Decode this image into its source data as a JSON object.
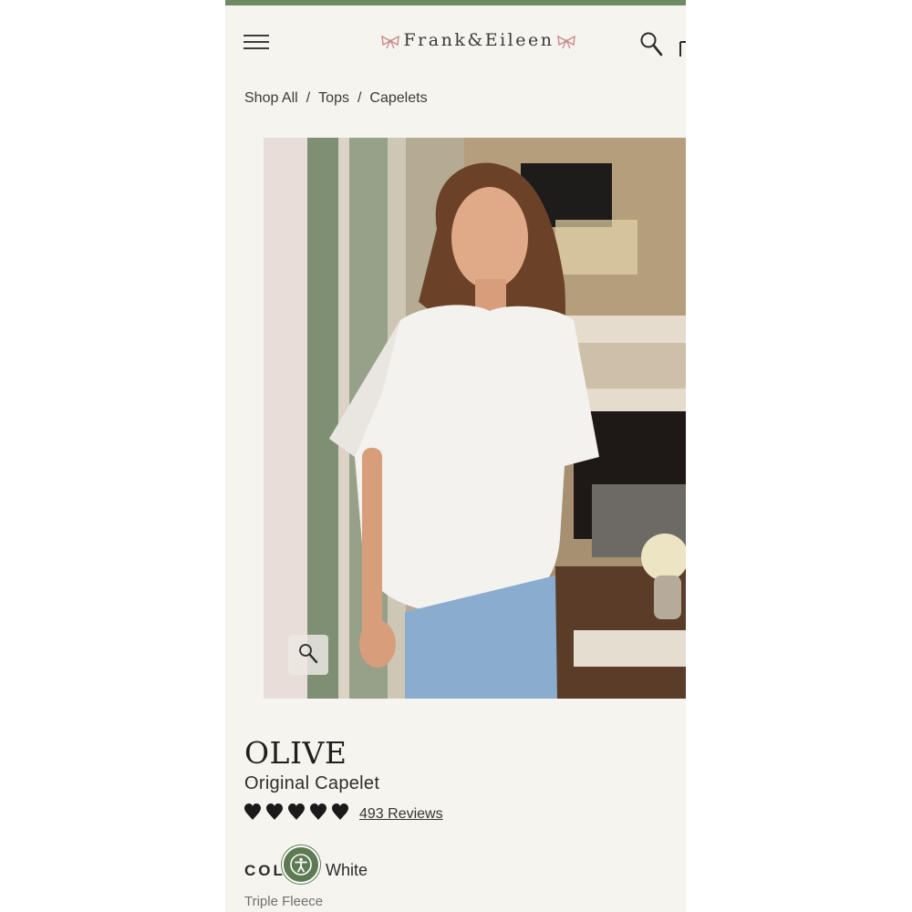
{
  "header": {
    "logo_text": "Frank&Eileen",
    "menu_icon": "hamburger-menu-icon",
    "search_icon": "search-icon",
    "cart_icon": "cart-icon",
    "accent_color": "#6e8b63"
  },
  "breadcrumb": {
    "items": [
      "Shop All",
      "Tops",
      "Capelets"
    ],
    "separator": "/"
  },
  "gallery": {
    "zoom_icon": "zoom-icon"
  },
  "product": {
    "brand_name": "OLIVE",
    "product_name": "Original Capelet",
    "rating_hearts": 5,
    "reviews_label": "493 Reviews",
    "color_label": "COLOR:",
    "color_value": "White",
    "fabric": "Triple Fleece"
  },
  "accessibility": {
    "icon": "accessibility-icon",
    "color": "#5d7a53"
  }
}
